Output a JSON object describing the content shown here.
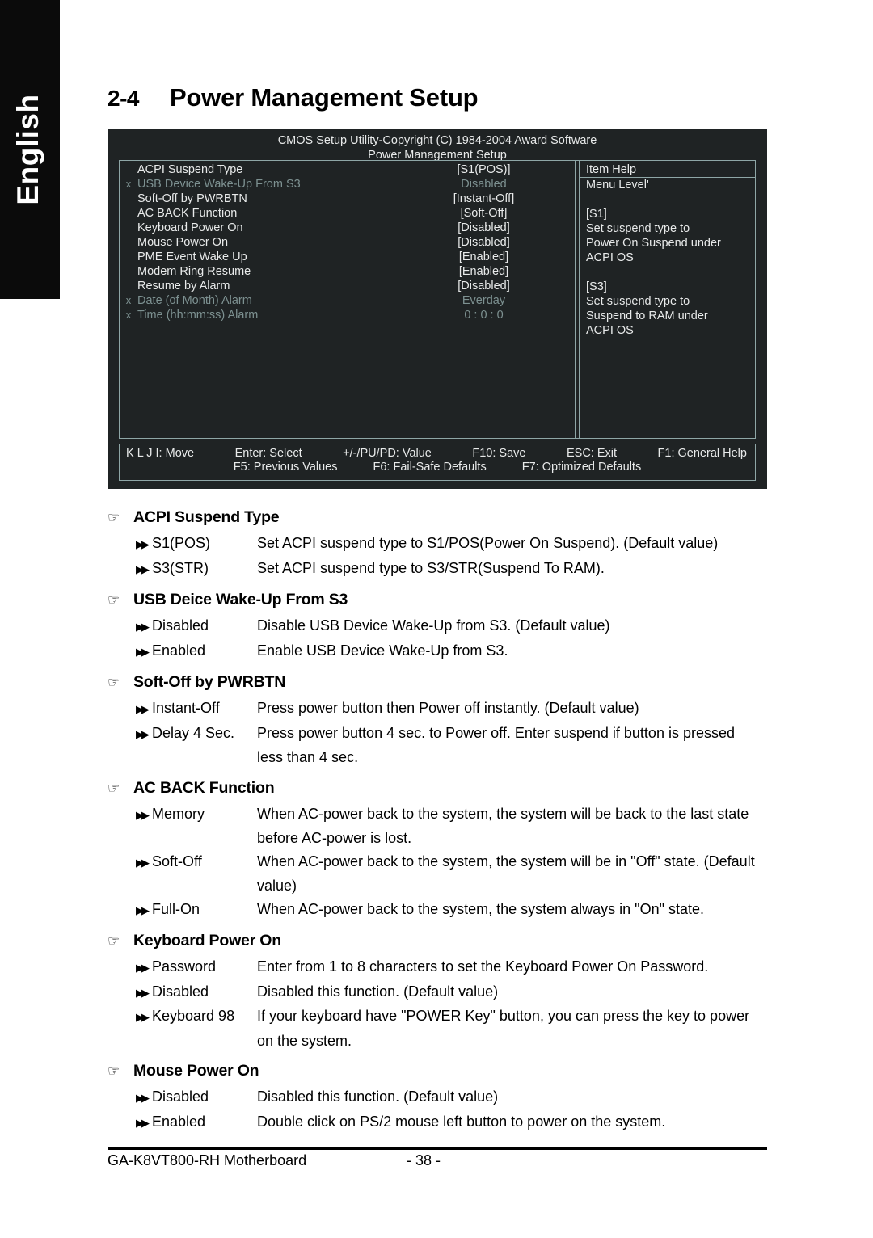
{
  "language_tab": {
    "label": "English"
  },
  "heading": {
    "number": "2-4",
    "title": "Power Management Setup"
  },
  "bios": {
    "title_line1": "CMOS Setup Utility-Copyright (C) 1984-2004 Award Software",
    "title_line2": "Power Management Setup",
    "rows": [
      {
        "x": "",
        "label": "ACPI Suspend Type",
        "value": "[S1(POS)]",
        "dim": false
      },
      {
        "x": "x",
        "label": "USB Device Wake-Up From S3",
        "value": "Disabled",
        "dim": true
      },
      {
        "x": "",
        "label": "Soft-Off by PWRBTN",
        "value": "[Instant-Off]",
        "dim": false
      },
      {
        "x": "",
        "label": "AC BACK Function",
        "value": "[Soft-Off]",
        "dim": false
      },
      {
        "x": "",
        "label": "Keyboard Power On",
        "value": "[Disabled]",
        "dim": false
      },
      {
        "x": "",
        "label": "Mouse Power On",
        "value": "[Disabled]",
        "dim": false
      },
      {
        "x": "",
        "label": "PME Event Wake Up",
        "value": "[Enabled]",
        "dim": false
      },
      {
        "x": "",
        "label": "Modem Ring Resume",
        "value": "[Enabled]",
        "dim": false
      },
      {
        "x": "",
        "label": "Resume by Alarm",
        "value": "[Disabled]",
        "dim": false
      },
      {
        "x": "x",
        "label": "Date (of Month) Alarm",
        "value": "Everday",
        "dim": true
      },
      {
        "x": "x",
        "label": "Time (hh:mm:ss) Alarm",
        "value": "0 : 0 : 0",
        "dim": true
      }
    ],
    "help": {
      "title": "Item Help",
      "lines": [
        "Menu Level'",
        "",
        "[S1]",
        "Set suspend type to",
        "Power On Suspend under",
        "ACPI OS",
        "",
        "[S3]",
        "Set suspend type to",
        "Suspend to RAM under",
        "ACPI OS"
      ]
    },
    "footer": {
      "row1": [
        "K L J I: Move",
        "Enter: Select",
        "+/-/PU/PD: Value",
        "F10: Save",
        "ESC: Exit",
        "F1: General Help"
      ],
      "row2": [
        "F5: Previous Values",
        "F6: Fail-Safe Defaults",
        "F7: Optimized Defaults"
      ]
    }
  },
  "icons": {
    "hand": "☞",
    "marker": "▶▶"
  },
  "sections": [
    {
      "title": "ACPI Suspend Type",
      "options": [
        {
          "name": "S1(POS)",
          "desc": "Set ACPI suspend type to S1/POS(Power On Suspend). (Default value)",
          "cont": ""
        },
        {
          "name": "S3(STR)",
          "desc": "Set ACPI suspend type to S3/STR(Suspend To RAM).",
          "cont": ""
        }
      ]
    },
    {
      "title": "USB Deice Wake-Up From S3",
      "options": [
        {
          "name": "Disabled",
          "desc": "Disable USB Device Wake-Up from S3. (Default value)",
          "cont": ""
        },
        {
          "name": "Enabled",
          "desc": "Enable USB Device Wake-Up from S3.",
          "cont": ""
        }
      ]
    },
    {
      "title": "Soft-Off by PWRBTN",
      "options": [
        {
          "name": "Instant-Off",
          "desc": "Press power button then Power off instantly. (Default value)",
          "cont": ""
        },
        {
          "name": "Delay 4 Sec.",
          "desc": "Press power button 4 sec. to Power off. Enter suspend if button is pressed",
          "cont": "less than 4 sec."
        }
      ]
    },
    {
      "title": "AC BACK Function",
      "options": [
        {
          "name": "Memory",
          "desc": "When AC-power back to the system, the system will be back to the last state",
          "cont": "before AC-power is lost."
        },
        {
          "name": "Soft-Off",
          "desc": "When AC-power back to the system, the system will be in \"Off\" state. (Default",
          "cont": "value)"
        },
        {
          "name": "Full-On",
          "desc": "When AC-power back to the system, the system always in \"On\" state.",
          "cont": ""
        }
      ]
    },
    {
      "title": "Keyboard Power On",
      "options": [
        {
          "name": "Password",
          "desc": "Enter from 1 to 8 characters to set the Keyboard Power On Password.",
          "cont": ""
        },
        {
          "name": "Disabled",
          "desc": "Disabled this function. (Default value)",
          "cont": ""
        },
        {
          "name": "Keyboard 98",
          "desc": "If your keyboard have \"POWER Key\" button, you can press the key to power",
          "cont": "on the system."
        }
      ]
    },
    {
      "title": "Mouse Power On",
      "options": [
        {
          "name": "Disabled",
          "desc": "Disabled this function. (Default value)",
          "cont": ""
        },
        {
          "name": "Enabled",
          "desc": "Double click on PS/2 mouse left button to power on the system.",
          "cont": ""
        }
      ]
    }
  ],
  "page_footer": {
    "product": "GA-K8VT800-RH Motherboard",
    "page_number": "- 38 -"
  }
}
